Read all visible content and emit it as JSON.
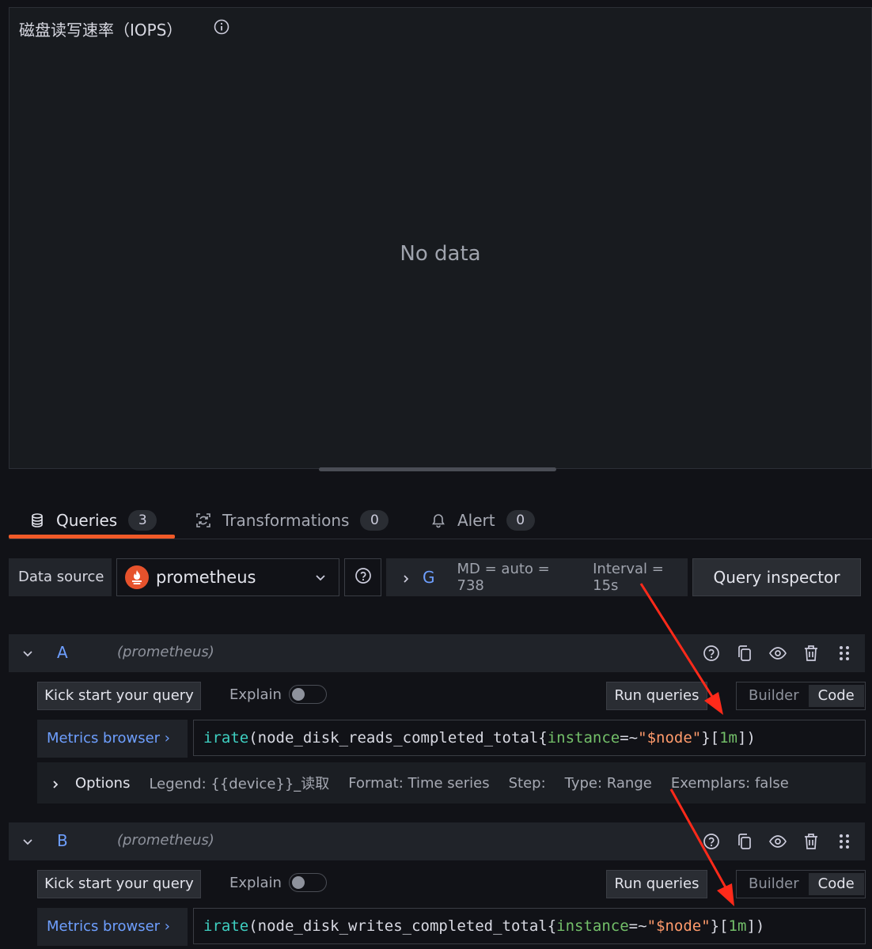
{
  "panel": {
    "title": "磁盘读写速率（IOPS）",
    "no_data": "No data"
  },
  "tabs": [
    {
      "label": "Queries",
      "count": "3",
      "active": true
    },
    {
      "label": "Transformations",
      "count": "0"
    },
    {
      "label": "Alert",
      "count": "0"
    }
  ],
  "datasource": {
    "label": "Data source",
    "selected": "prometheus",
    "glyph": "G",
    "md": "MD = auto = 738",
    "interval": "Interval = 15s",
    "query_inspector": "Query inspector"
  },
  "queries": [
    {
      "name": "A",
      "datasource": "(prometheus)",
      "kick_start": "Kick start your query",
      "explain": "Explain",
      "run": "Run queries",
      "builder": "Builder",
      "code": "Code",
      "metrics_browser": "Metrics browser ›",
      "expr": {
        "fn": "irate",
        "open": "(",
        "metric": "node_disk_reads_completed_total",
        "lbrace": "{",
        "label": "instance",
        "op": "=~",
        "value": "\"$node\"",
        "rbrace": "}",
        "range_open": "[",
        "range": "1m",
        "range_close": "])"
      },
      "options": {
        "label": "Options",
        "legend": "Legend: {{device}}_读取",
        "format": "Format: Time series",
        "step": "Step:",
        "type": "Type: Range",
        "exemplars": "Exemplars: false"
      }
    },
    {
      "name": "B",
      "datasource": "(prometheus)",
      "kick_start": "Kick start your query",
      "explain": "Explain",
      "run": "Run queries",
      "builder": "Builder",
      "code": "Code",
      "metrics_browser": "Metrics browser ›",
      "expr": {
        "fn": "irate",
        "open": "(",
        "metric": "node_disk_writes_completed_total",
        "lbrace": "{",
        "label": "instance",
        "op": "=~",
        "value": "\"$node\"",
        "rbrace": "}",
        "range_open": "[",
        "range": "1m",
        "range_close": "])"
      }
    }
  ],
  "colors": {
    "accent": "#f05a28",
    "link": "#6e9fff",
    "annotation_arrow": "#ff2a1a"
  }
}
